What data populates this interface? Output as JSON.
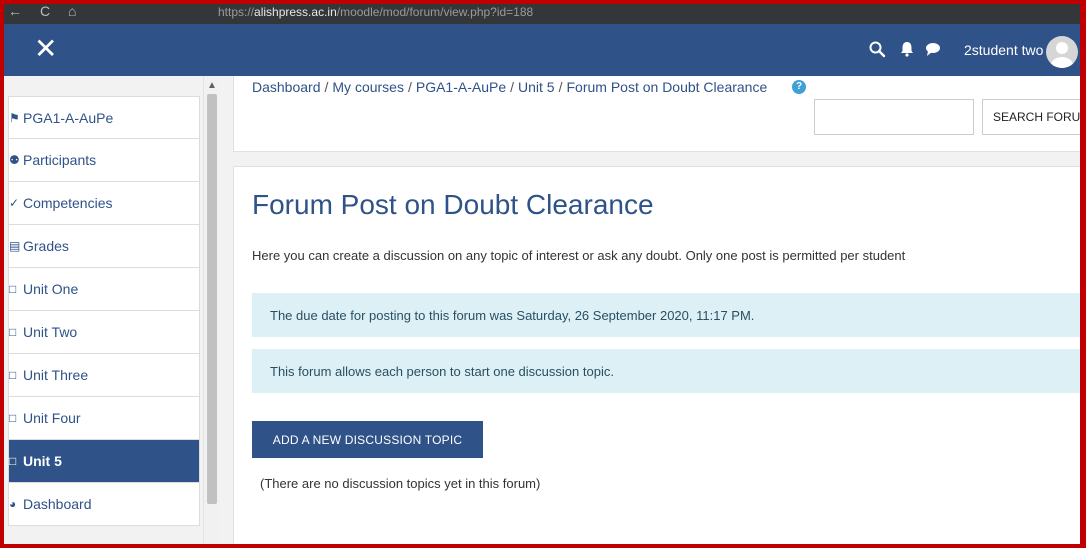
{
  "browser": {
    "nav_back": "←",
    "nav_reload": "C",
    "nav_home": "⌂",
    "url_prefix": "https://",
    "url_host": "alishpress.ac.in",
    "url_path": "/moodle/mod/forum/view.php?id=188"
  },
  "navbar": {
    "close_label": "✕",
    "user_name": "2student two",
    "icons": [
      "search-icon",
      "bell-icon",
      "chat-icon"
    ]
  },
  "sidebar": {
    "items": [
      {
        "label": "PGA1-A-AuPe",
        "icon": "⚑"
      },
      {
        "label": "Participants",
        "icon": "⚉"
      },
      {
        "label": "Competencies",
        "icon": "✓"
      },
      {
        "label": "Grades",
        "icon": "▤"
      },
      {
        "label": "Unit One",
        "icon": "□"
      },
      {
        "label": "Unit Two",
        "icon": "□"
      },
      {
        "label": "Unit Three",
        "icon": "□"
      },
      {
        "label": "Unit Four",
        "icon": "□"
      },
      {
        "label": "Unit 5",
        "icon": "□",
        "active": true
      },
      {
        "label": "Dashboard",
        "icon": "◕"
      }
    ]
  },
  "breadcrumb": {
    "items": [
      "Dashboard",
      "My courses",
      "PGA1-A-AuPe",
      "Unit 5",
      "Forum Post on Doubt Clearance"
    ],
    "separator": "/"
  },
  "search": {
    "value": "",
    "button_label": "SEARCH FORUMS",
    "help_label": "?"
  },
  "main": {
    "title": "Forum Post on Doubt Clearance",
    "intro": "Here you can create a discussion on any topic of interest or ask any doubt. Only one post is permitted per student",
    "alerts": [
      "The due date for posting to this forum was Saturday, 26 September 2020, 11:17 PM.",
      "This forum allows each person to start one discussion topic."
    ],
    "add_button_label": "ADD A NEW DISCUSSION TOPIC",
    "empty_note": "(There are no discussion topics yet in this forum)"
  },
  "colors": {
    "brand": "#2f5289",
    "alert_bg": "#dcf0f5",
    "frame": "#c00000"
  }
}
